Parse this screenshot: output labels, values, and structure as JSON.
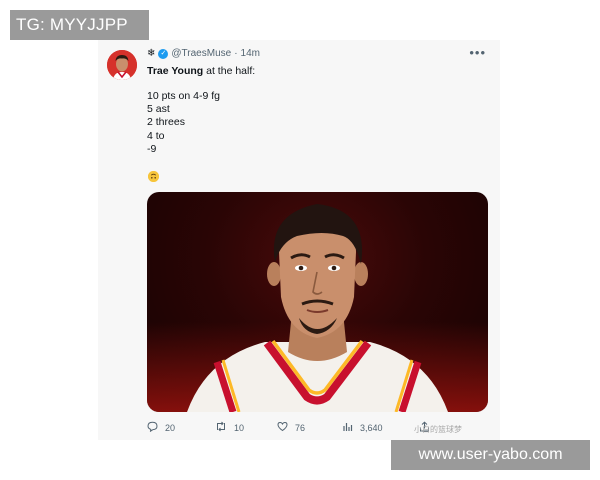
{
  "overlay": {
    "tg_label": "TG: MYYJJPP",
    "url_label": "www.user-yabo.com"
  },
  "tweet": {
    "header_glyph": "❄",
    "handle": "@TraesMuse",
    "separator": "·",
    "time": "14m",
    "more_icon": "more-horizontal-icon",
    "name_bold": "Trae Young",
    "name_rest": " at the half:",
    "stat_lines": [
      "10 pts on 4-9 fg",
      "5 ast",
      "2 threes",
      "4 to",
      "-9"
    ],
    "emoji_icon": "upside-down-face-emoji",
    "media": {
      "subject": "player-illustration",
      "background_colors": [
        "#4a0a0a",
        "#160303"
      ]
    }
  },
  "actions": {
    "reply_count": "20",
    "retweet_count": "10",
    "like_count": "76",
    "views_count": "3,640",
    "reply_icon": "reply-icon",
    "retweet_icon": "retweet-icon",
    "like_icon": "heart-icon",
    "views_icon": "views-icon",
    "share_icon": "share-icon"
  },
  "watermark": "小白的篮球梦",
  "colors": {
    "verified": "#1d9bf0",
    "avatar_bg": "#d6312b",
    "jersey_red": "#c8102e",
    "jersey_yellow": "#fdb927"
  }
}
